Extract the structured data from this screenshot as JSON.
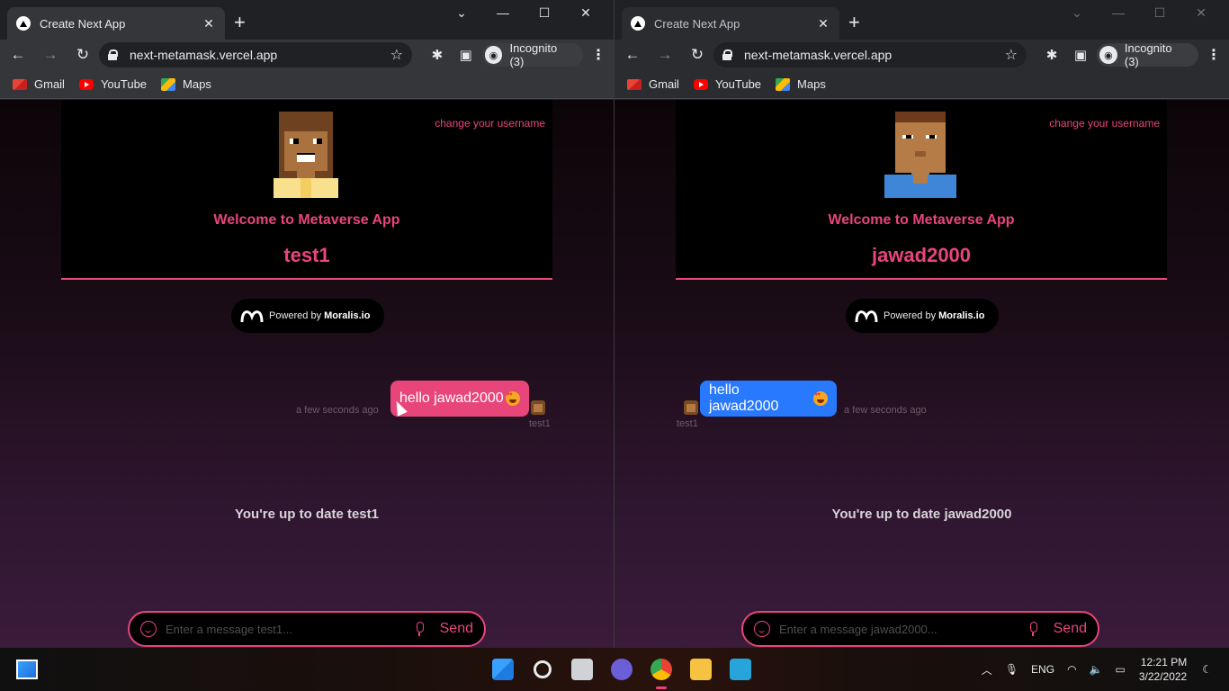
{
  "windows": [
    {
      "tab_title": "Create Next App",
      "url": "next-metamask.vercel.app",
      "incognito_label": "Incognito (3)",
      "bookmarks": [
        "Gmail",
        "YouTube",
        "Maps"
      ],
      "change_username": "change your username",
      "welcome": "Welcome to Metaverse App",
      "username": "test1",
      "powered_by": "Powered by",
      "powered_brand": "Moralis.io",
      "message_text": "hello jawad2000",
      "message_time": "a few seconds ago",
      "message_sender": "test1",
      "up_to_date": "You're up to date test1",
      "input_placeholder": "Enter a message test1...",
      "send_label": "Send",
      "bubble_color": "#e8457b"
    },
    {
      "tab_title": "Create Next App",
      "url": "next-metamask.vercel.app",
      "incognito_label": "Incognito (3)",
      "bookmarks": [
        "Gmail",
        "YouTube",
        "Maps"
      ],
      "change_username": "change your username",
      "welcome": "Welcome to Metaverse App",
      "username": "jawad2000",
      "powered_by": "Powered by",
      "powered_brand": "Moralis.io",
      "message_text": "hello jawad2000",
      "message_time": "a few seconds ago",
      "message_sender": "test1",
      "up_to_date": "You're up to date jawad2000",
      "input_placeholder": "Enter a message jawad2000...",
      "send_label": "Send",
      "bubble_color": "#2979ff"
    }
  ],
  "taskbar": {
    "language": "ENG",
    "time": "12:21 PM",
    "date": "3/22/2022"
  },
  "colors": {
    "accent": "#e8457b",
    "chrome_dark": "#202124",
    "chrome_toolbar": "#35363a"
  }
}
